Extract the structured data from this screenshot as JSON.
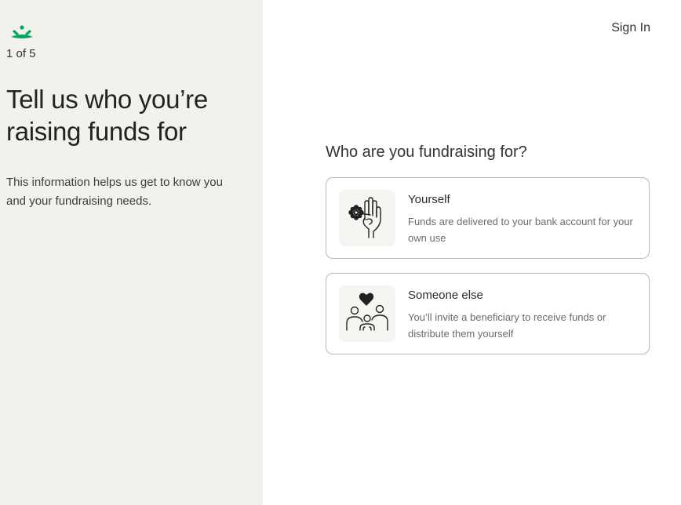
{
  "brand": {
    "logo_icon": "sprout-logo-icon",
    "accent": "#02a95c"
  },
  "progress": {
    "step_label": "1 of 5",
    "current": 1,
    "total": 5
  },
  "intro": {
    "heading": "Tell us who you’re raising funds for",
    "subtext": "This information helps us get to know you and your fundraising needs."
  },
  "header": {
    "signin_label": "Sign In"
  },
  "form": {
    "question": "Who are you fundraising for?",
    "options": [
      {
        "title": "Yourself",
        "description": "Funds are delivered to your bank account for your own use",
        "icon": "hand-with-flower-icon"
      },
      {
        "title": "Someone else",
        "description": "You’ll invite a beneficiary to receive funds or distribute them yourself",
        "icon": "people-with-heart-icon"
      }
    ]
  }
}
